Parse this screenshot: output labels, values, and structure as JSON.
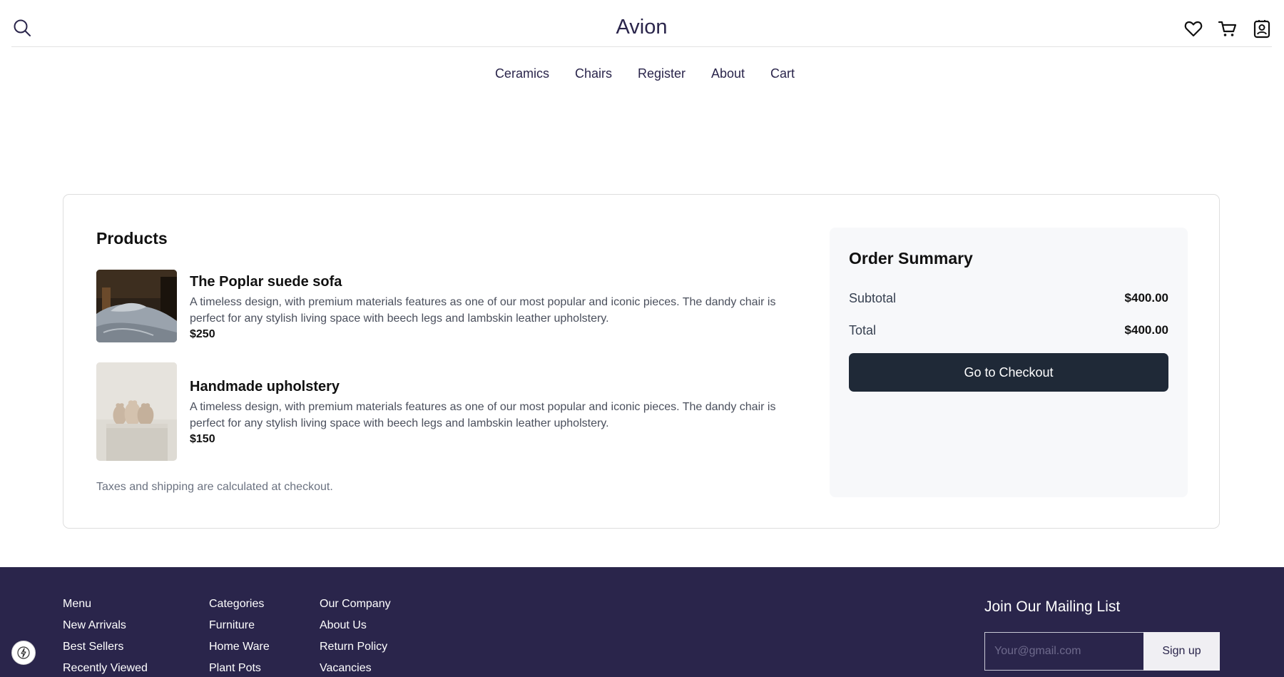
{
  "header": {
    "brand": "Avion",
    "search_icon": "search-icon",
    "icons": [
      "heart-icon",
      "cart-icon",
      "user-icon"
    ]
  },
  "nav": {
    "items": [
      "Ceramics",
      "Chairs",
      "Register",
      "About",
      "Cart"
    ]
  },
  "cart": {
    "title": "Products",
    "products": [
      {
        "name": "The Poplar suede sofa",
        "description": "A timeless design, with premium materials features as one of our most popular and iconic pieces. The dandy chair is perfect for any stylish living space with beech legs and lambskin leather upholstery.",
        "price": "$250"
      },
      {
        "name": "Handmade upholstery",
        "description": "A timeless design, with premium materials features as one of our most popular and iconic pieces. The dandy chair is perfect for any stylish living space with beech legs and lambskin leather upholstery.",
        "price": "$150"
      }
    ],
    "tax_note": "Taxes and shipping are calculated at checkout."
  },
  "summary": {
    "title": "Order Summary",
    "subtotal_label": "Subtotal",
    "subtotal_value": "$400.00",
    "total_label": "Total",
    "total_value": "$400.00",
    "checkout_label": "Go to Checkout"
  },
  "footer": {
    "columns": [
      {
        "title": "Menu",
        "links": [
          "New Arrivals",
          "Best Sellers",
          "Recently Viewed"
        ]
      },
      {
        "title": "Categories",
        "links": [
          "Furniture",
          "Home Ware",
          "Plant Pots"
        ]
      },
      {
        "title": "Our Company",
        "links": [
          "About Us",
          "Return Policy",
          "Vacancies"
        ]
      }
    ],
    "mailing": {
      "title": "Join Our Mailing List",
      "placeholder": "Your@gmail.com",
      "button": "Sign up"
    }
  },
  "colors": {
    "brand": "#2a254b",
    "checkout_button": "#1f2937",
    "summary_bg": "#f7f8fa"
  }
}
